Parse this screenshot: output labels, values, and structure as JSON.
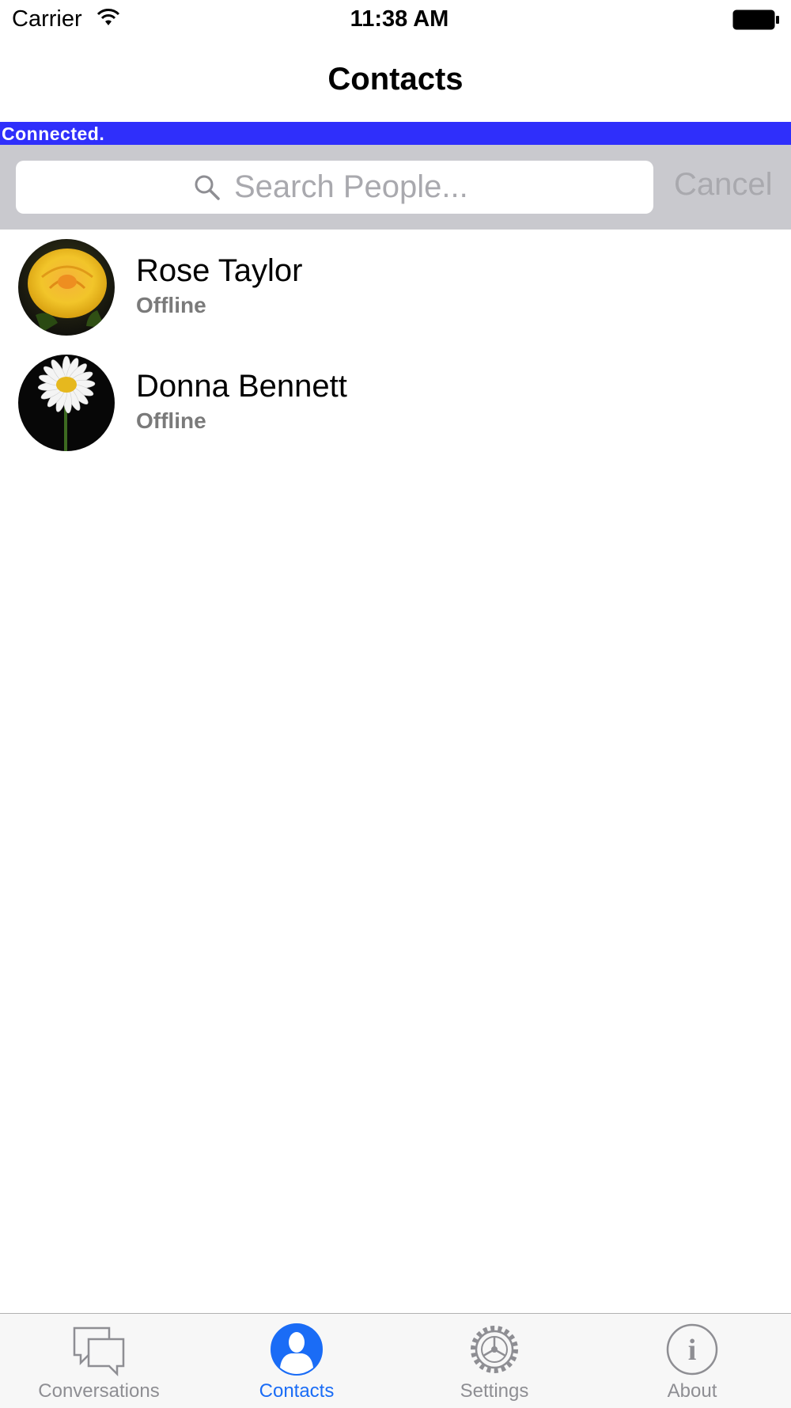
{
  "status_bar": {
    "carrier": "Carrier",
    "time": "11:38 AM"
  },
  "nav": {
    "title": "Contacts"
  },
  "connection": {
    "text": "Connected.",
    "color": "#2f2ffb"
  },
  "search": {
    "placeholder": "Search People...",
    "value": "",
    "cancel_label": "Cancel"
  },
  "contacts": [
    {
      "name": "Rose Taylor",
      "status": "Offline",
      "avatar_icon": "yellow-rose-photo"
    },
    {
      "name": "Donna Bennett",
      "status": "Offline",
      "avatar_icon": "white-daisy-photo"
    }
  ],
  "tabs": [
    {
      "label": "Conversations",
      "icon": "conversations-icon",
      "active": false
    },
    {
      "label": "Contacts",
      "icon": "contacts-icon",
      "active": true
    },
    {
      "label": "Settings",
      "icon": "settings-icon",
      "active": false
    },
    {
      "label": "About",
      "icon": "about-icon",
      "active": false
    }
  ],
  "colors": {
    "accent": "#1a6cf6",
    "inactive": "#8e8e93",
    "search_bar": "#c9c9ce"
  }
}
